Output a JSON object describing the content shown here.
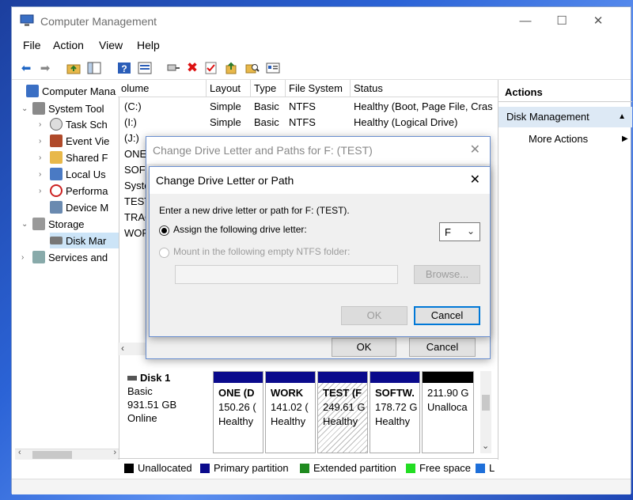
{
  "window": {
    "title": "Computer Management",
    "minimize_glyph": "—",
    "maximize_glyph": "☐",
    "close_glyph": "✕"
  },
  "menu": [
    "File",
    "Action",
    "View",
    "Help"
  ],
  "toolbar_icons": [
    "back-arrow-icon",
    "forward-arrow-icon",
    "up-folder-icon",
    "show-hide-tree-icon",
    "help-icon",
    "console-view-icon",
    "connect-icon",
    "delete-icon",
    "checkmark-icon",
    "export-icon",
    "search-folder-icon",
    "properties-icon"
  ],
  "tree": {
    "root": "Computer Mana",
    "system_tools": "System Tool",
    "task_scheduler": "Task Sch",
    "event_viewer": "Event Vie",
    "shared_folders": "Shared F",
    "local_users": "Local Us",
    "performance": "Performa",
    "device_manager": "Device M",
    "storage": "Storage",
    "disk_management": "Disk Mar",
    "services": "Services and"
  },
  "volume_list": {
    "columns": [
      "olume",
      "Layout",
      "Type",
      "File System",
      "Status"
    ],
    "rows": [
      {
        "volume": "(C:)",
        "layout": "Simple",
        "type": "Basic",
        "fs": "NTFS",
        "status": "Healthy (Boot, Page File, Cras"
      },
      {
        "volume": "(I:)",
        "layout": "Simple",
        "type": "Basic",
        "fs": "NTFS",
        "status": "Healthy (Logical Drive)"
      },
      {
        "volume": "(J:)",
        "layout": "",
        "type": "",
        "fs": "",
        "status": ""
      },
      {
        "volume": "ONE",
        "layout": "",
        "type": "",
        "fs": "",
        "status": ""
      },
      {
        "volume": "SOFT",
        "layout": "",
        "type": "",
        "fs": "",
        "status": ""
      },
      {
        "volume": "Syste",
        "layout": "",
        "type": "",
        "fs": "",
        "status": ""
      },
      {
        "volume": "TEST",
        "layout": "",
        "type": "",
        "fs": "",
        "status": ""
      },
      {
        "volume": "TRAC",
        "layout": "",
        "type": "",
        "fs": "",
        "status": ""
      },
      {
        "volume": "WOR",
        "layout": "",
        "type": "",
        "fs": "",
        "status": ""
      }
    ]
  },
  "actions": {
    "header": "Actions",
    "section": "Disk Management",
    "more": "More Actions"
  },
  "disk": {
    "name": "Disk 1",
    "type": "Basic",
    "size": "931.51 GB",
    "state": "Online",
    "partitions": [
      {
        "label": "ONE (D",
        "size": "150.26 (",
        "status": "Healthy"
      },
      {
        "label": "WORK",
        "size": "141.02 (",
        "status": "Healthy"
      },
      {
        "label": "TEST (F",
        "size": "249.61 G",
        "status": "Healthy"
      },
      {
        "label": "SOFTW.",
        "size": "178.72 G",
        "status": "Healthy"
      },
      {
        "label": "",
        "size": "211.90 G",
        "status": "Unalloca"
      }
    ]
  },
  "legend": [
    {
      "label": "Unallocated",
      "color": "#000000"
    },
    {
      "label": "Primary partition",
      "color": "#0a0a8c"
    },
    {
      "label": "Extended partition",
      "color": "#1f8a1f"
    },
    {
      "label": "Free space",
      "color": "#22dd22"
    },
    {
      "label": "L",
      "color": "#1e6fd9"
    }
  ],
  "dialog_outer": {
    "title": "Change Drive Letter and Paths for F: (TEST)",
    "ok": "OK",
    "cancel": "Cancel"
  },
  "dialog_inner": {
    "title": "Change Drive Letter or Path",
    "instruction": "Enter a new drive letter or path for F: (TEST).",
    "assign_label": "Assign the following drive letter:",
    "drive_letter": "F",
    "mount_label": "Mount in the following empty NTFS folder:",
    "folder_value": "",
    "browse": "Browse...",
    "ok": "OK",
    "cancel": "Cancel"
  }
}
